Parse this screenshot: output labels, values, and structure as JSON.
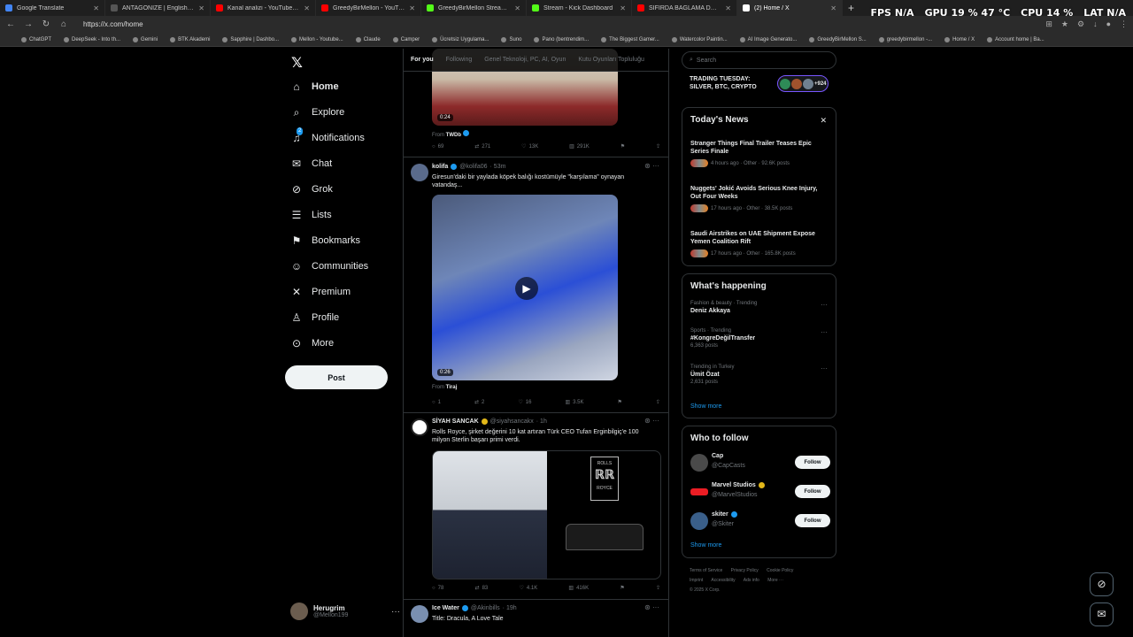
{
  "browser": {
    "tabs": [
      {
        "label": "Google Translate",
        "color": "#4285f4"
      },
      {
        "label": "ANTAGONIZE | English meaning -",
        "color": "#555555"
      },
      {
        "label": "Kanal analizi - YouTube Studio",
        "color": "#ff0000"
      },
      {
        "label": "GreedyBirMellon - YouTube",
        "color": "#ff0000"
      },
      {
        "label": "GreedyBirMellon Stream - Watch",
        "color": "#53fc18"
      },
      {
        "label": "Stream - Kick Dashboard",
        "color": "#53fc18"
      },
      {
        "label": "SIFIRDA BAĞLAMA DERSİ 5 | Nota",
        "color": "#ff0000"
      },
      {
        "label": "(2) Home / X",
        "color": "#000000"
      }
    ],
    "url": "https://x.com/home",
    "overlay": {
      "fps_label": "FPS",
      "fps": "N/A",
      "gpu_label": "GPU",
      "gpu": "19 % 47 °C",
      "cpu_label": "CPU",
      "cpu": "14 %",
      "lat_label": "LAT",
      "lat": "N/A"
    },
    "bookmarks": [
      "ChatGPT",
      "DeepSeek - Into th...",
      "Gemini",
      "BTK Akademi",
      "Sapphire | Dashbo...",
      "Mellon - Youtube...",
      "Claude",
      "Camper",
      "Ücretsiz Uygulama...",
      "Suno",
      "Pano (bentrendim...",
      "The Biggest Gamer...",
      "Watercolor Paintin...",
      "AI Image Generato...",
      "GreedyBirMellon S...",
      "greedybirmellon -...",
      "Home / X",
      "Account home | Ba..."
    ]
  },
  "nav": {
    "items": [
      {
        "label": "Home",
        "icon": "home-icon"
      },
      {
        "label": "Explore",
        "icon": "search-icon"
      },
      {
        "label": "Notifications",
        "icon": "bell-icon",
        "badge": "2"
      },
      {
        "label": "Chat",
        "icon": "mail-icon"
      },
      {
        "label": "Grok",
        "icon": "grok-icon"
      },
      {
        "label": "Lists",
        "icon": "list-icon"
      },
      {
        "label": "Bookmarks",
        "icon": "bookmark-icon"
      },
      {
        "label": "Communities",
        "icon": "people-icon"
      },
      {
        "label": "Premium",
        "icon": "x-icon"
      },
      {
        "label": "Profile",
        "icon": "person-icon"
      },
      {
        "label": "More",
        "icon": "more-circle-icon"
      }
    ],
    "post_label": "Post",
    "account": {
      "name": "Herugrim",
      "handle": "@Mellon199"
    }
  },
  "feed": {
    "tabs": [
      "For you",
      "Following",
      "Genel Teknoloji, PC, AI, Oyun",
      "Kutu Oyunları Topluluğu"
    ],
    "tweet0": {
      "duration": "0:24",
      "from_label": "From",
      "from": "TWDb",
      "stats": {
        "replies": "69",
        "reposts": "271",
        "likes": "13K",
        "views": "291K"
      }
    },
    "tweet1": {
      "name": "kolifa",
      "handle": "@kolifa06",
      "time": "· 53m",
      "text": "Giresun'daki bir yaylada köpek balığı kostümüyle \"karşılama\" oynayan vatandaş...",
      "duration": "0:26",
      "from_label": "From",
      "from": "Tiraj",
      "stats": {
        "replies": "1",
        "reposts": "2",
        "likes": "16",
        "views": "3.5K"
      }
    },
    "tweet2": {
      "name": "SİYAH SANCAK",
      "handle": "@siyahsancakx",
      "time": "· 1h",
      "text": "Rolls Royce, şirket değerini 10 kat artıran Türk CEO Tufan Erginbilgiç'e 100 milyon Sterlin başarı primi verdi.",
      "logo_top": "ROLLS",
      "logo_bottom": "ROYCE",
      "stats": {
        "replies": "78",
        "reposts": "83",
        "likes": "4.1K",
        "views": "416K"
      }
    },
    "tweet3": {
      "name": "Ice Water",
      "handle": "@Akinbills",
      "time": "· 19h",
      "text": "Title: Dracula, A Love Tale"
    }
  },
  "right": {
    "search_placeholder": "Search",
    "trading": {
      "text": "TRADING TUESDAY: SILVER, BTC, CRYPTO",
      "count": "+924"
    },
    "news": {
      "title": "Today's News",
      "items": [
        {
          "title": "Stranger Things Final Trailer Teases Epic Series Finale",
          "meta": "4 hours ago · Other · 92.6K posts"
        },
        {
          "title": "Nuggets' Jokić Avoids Serious Knee Injury, Out Four Weeks",
          "meta": "17 hours ago · Other · 38.5K posts"
        },
        {
          "title": "Saudi Airstrikes on UAE Shipment Expose Yemen Coalition Rift",
          "meta": "17 hours ago · Other · 165.8K posts"
        }
      ]
    },
    "happening": {
      "title": "What's happening",
      "items": [
        {
          "context": "Fashion & beauty · Trending",
          "name": "Deniz Akkaya",
          "count": ""
        },
        {
          "context": "Sports · Trending",
          "name": "#KongreDeğilTransfer",
          "count": "6,363 posts"
        },
        {
          "context": "Trending in Turkey",
          "name": "Ümit Özat",
          "count": "2,631 posts"
        }
      ],
      "show_more": "Show more"
    },
    "who_to_follow": {
      "title": "Who to follow",
      "items": [
        {
          "name": "Cap",
          "handle": "@CapCasts",
          "color": "#4a4a4a"
        },
        {
          "name": "Marvel Studios",
          "handle": "@MarvelStudios",
          "color": "#ec1d24"
        },
        {
          "name": "skiter",
          "handle": "@Skiter",
          "color": "#3a5f8a"
        }
      ],
      "follow_label": "Follow",
      "show_more": "Show more"
    },
    "footer": [
      "Terms of Service",
      "Privacy Policy",
      "Cookie Policy",
      "Imprint",
      "Accessibility",
      "Ads info",
      "More ···",
      "© 2025 X Corp."
    ]
  }
}
